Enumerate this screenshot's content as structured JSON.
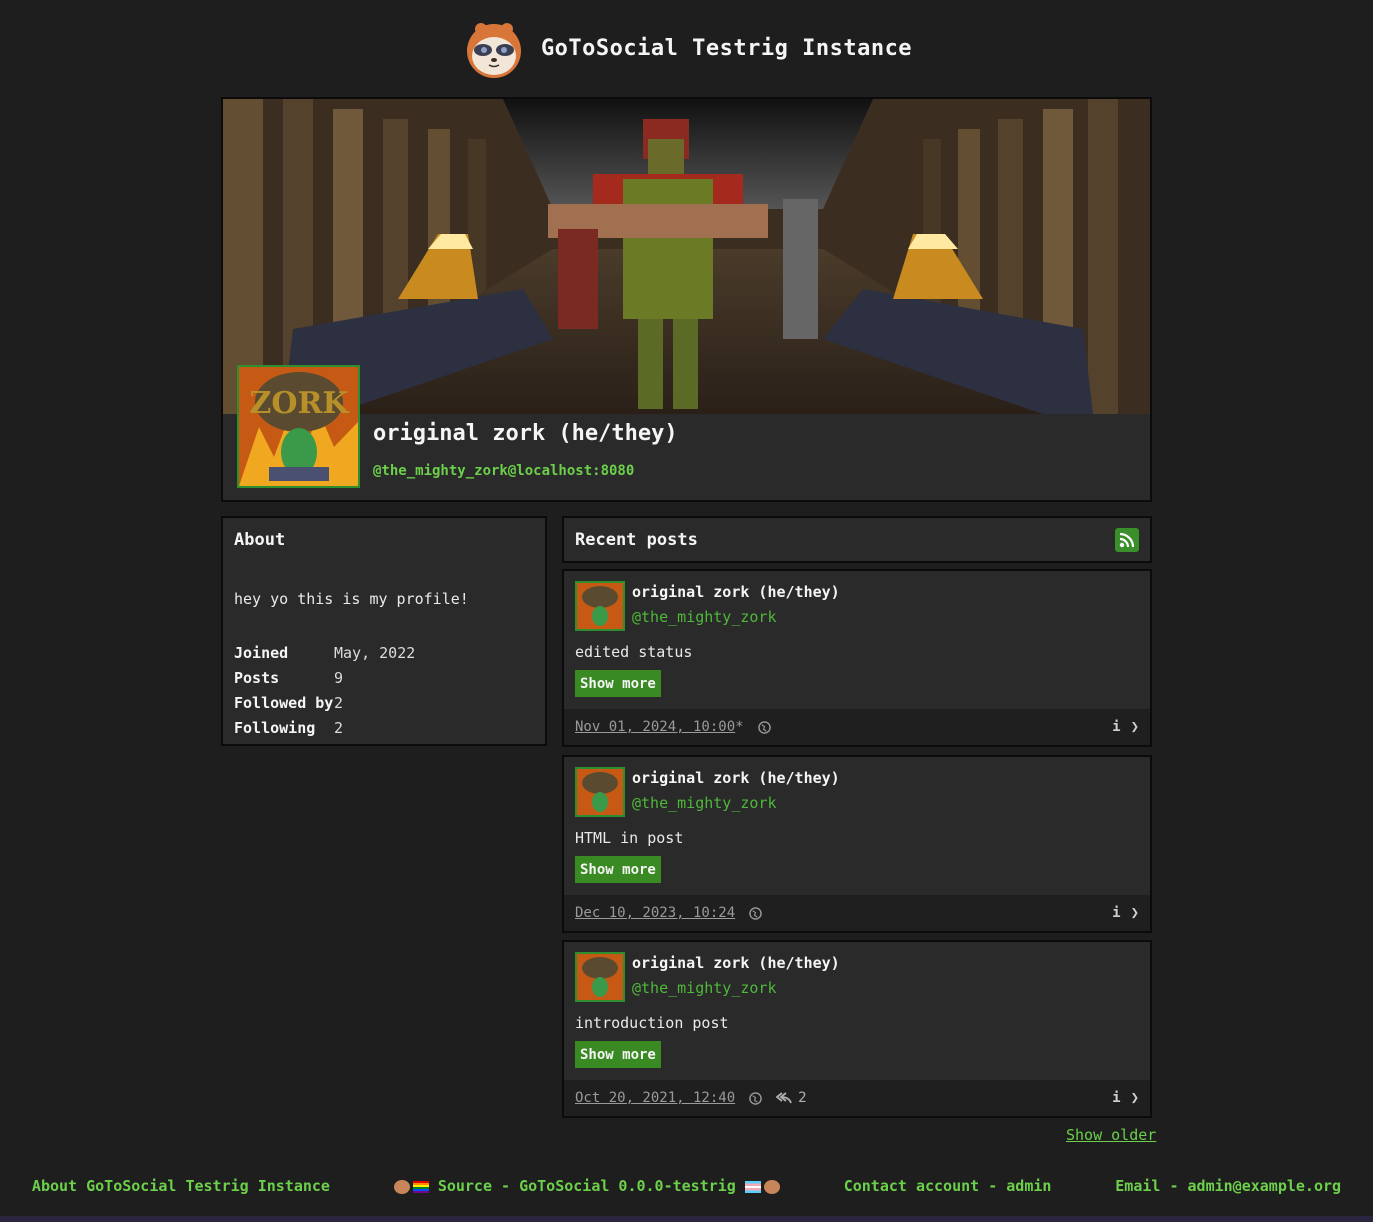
{
  "site": {
    "title": "GoToSocial Testrig Instance"
  },
  "profile": {
    "display_name": "original zork (he/they)",
    "handle": "@the_mighty_zork@localhost:8080"
  },
  "about": {
    "heading": "About",
    "bio": "hey yo this is my profile!",
    "stats": [
      {
        "label": "Joined",
        "value": "May, 2022"
      },
      {
        "label": "Posts",
        "value": "9"
      },
      {
        "label": "Followed by",
        "value": "2"
      },
      {
        "label": "Following",
        "value": "2"
      }
    ]
  },
  "recent": {
    "heading": "Recent posts"
  },
  "posts": [
    {
      "author": "original zork (he/they)",
      "handle": "@the_mighty_zork",
      "text": "edited status",
      "show_more": "Show more",
      "date": "Nov 01, 2024, 10:00",
      "edited_mark": "*",
      "replies": ""
    },
    {
      "author": "original zork (he/they)",
      "handle": "@the_mighty_zork",
      "text": "HTML in post",
      "show_more": "Show more",
      "date": "Dec 10, 2023, 10:24",
      "edited_mark": "",
      "replies": ""
    },
    {
      "author": "original zork (he/they)",
      "handle": "@the_mighty_zork",
      "text": "introduction post",
      "show_more": "Show more",
      "date": "Oct 20, 2021, 12:40",
      "edited_mark": "",
      "replies": "2"
    }
  ],
  "show_older": "Show older",
  "footer": {
    "about": "About GoToSocial Testrig Instance",
    "source": "Source - GoToSocial 0.0.0-testrig",
    "contact": "Contact account - admin",
    "email": "Email - admin@example.org"
  },
  "colors": {
    "accent": "#6cd04a",
    "button": "#3a8a24",
    "background": "#1e1e1e",
    "panel": "#2a2a2a"
  }
}
